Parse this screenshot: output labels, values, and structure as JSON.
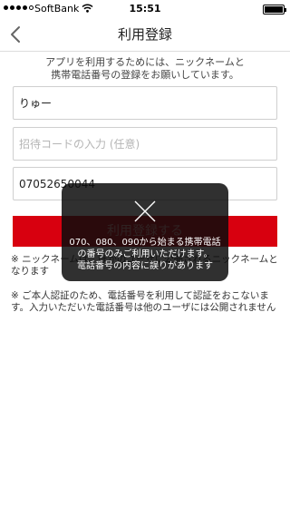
{
  "status_bar": {
    "carrier": "SoftBank",
    "time": "15:51"
  },
  "nav": {
    "title": "利用登録"
  },
  "intro": {
    "line1": "アプリを利用するためには、ニックネームと",
    "line2": "携帯電話番号の登録をお願いしています。"
  },
  "form": {
    "nickname_value": "りゅー",
    "invite_placeholder": "招待コードの入力 (任意)",
    "phone_value": "07052650044"
  },
  "register_button": "利用登録する",
  "notes": [
    "※ ニックネームは、ほかのユーザに公開されるニックネームとなります",
    "※ ご本人認証のため、電話番号を利用して認証をおこないます。入力いただいた電話番号は他のユーザには公開されません"
  ],
  "toast": {
    "line1": "070、080、090から始まる携帯電話",
    "line2": "の番号のみご利用いただけます。",
    "line3": "電話番号の内容に誤りがあります"
  }
}
